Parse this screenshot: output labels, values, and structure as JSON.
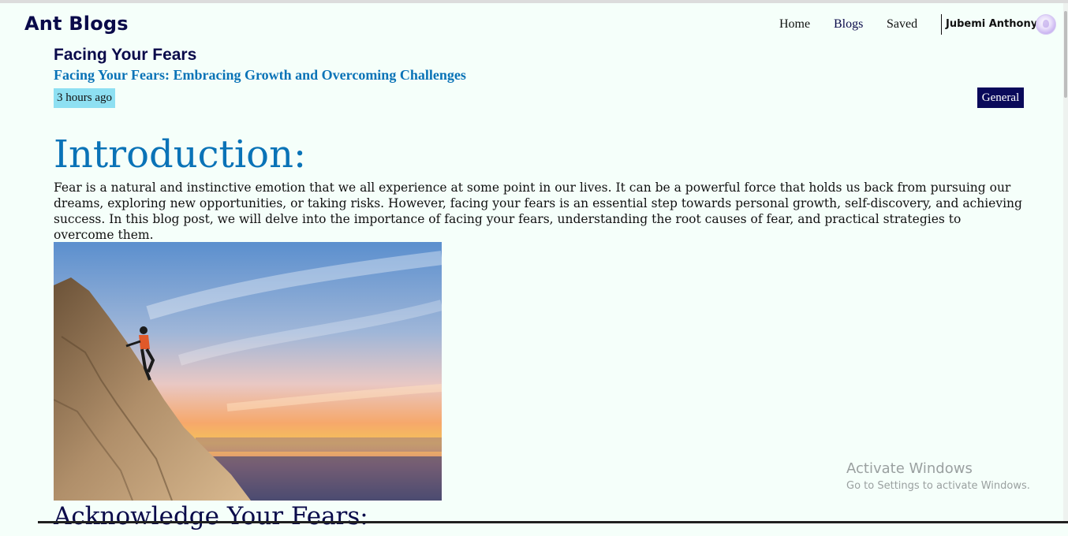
{
  "header": {
    "brand": "Ant Blogs",
    "nav": [
      {
        "label": "Home"
      },
      {
        "label": "Blogs"
      },
      {
        "label": "Saved"
      }
    ],
    "user": {
      "name": "Jubemi Anthony",
      "avatar_icon": "avatar-icon"
    }
  },
  "post": {
    "title": "Facing Your Fears",
    "subtitle": "Facing Your Fears: Embracing Growth and Overcoming Challenges",
    "time": "3 hours ago",
    "category": "General",
    "sections": [
      {
        "heading": "Introduction:",
        "body": "Fear is a natural and instinctive emotion that we all experience at some point in our lives. It can be a powerful force that holds us back from pursuing our dreams, exploring new opportunities, or taking risks. However, facing your fears is an essential step towards personal growth, self-discovery, and achieving success. In this blog post, we will delve into the importance of facing your fears, understanding the root causes of fear, and practical strategies to overcome them."
      },
      {
        "heading": "Acknowledge Your Fears:"
      }
    ]
  },
  "overlay": {
    "title": "Activate Windows",
    "subtitle": "Go to Settings to activate Windows."
  },
  "colors": {
    "brand": "#0a0a4a",
    "accent": "#0a73b7",
    "time_badge": "#8ee0f2",
    "category_badge": "#0a0a5a",
    "background": "#f5fffa"
  }
}
